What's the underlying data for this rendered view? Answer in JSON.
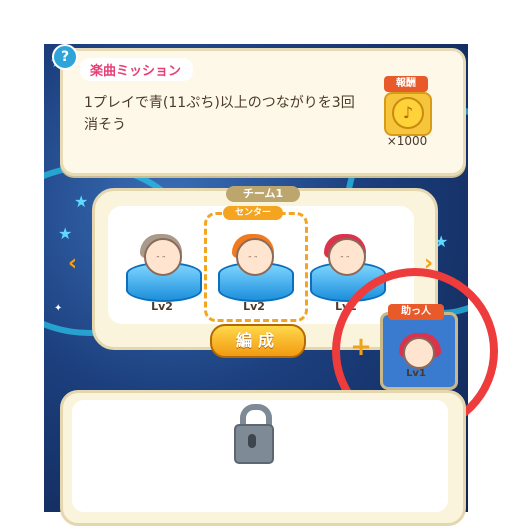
{
  "mission": {
    "title": "楽曲ミッション",
    "description": "1プレイで青(11ぷち)以上のつながりを3回消そう",
    "reward_label": "報酬",
    "reward_count": "×1000",
    "icons": {
      "help": "question-icon",
      "reward": "music-coin-icon"
    }
  },
  "team": {
    "label": "チーム1",
    "center_label": "センター",
    "members": [
      {
        "level": "Lv2",
        "hair_color": "#a99a8c"
      },
      {
        "level": "Lv2",
        "hair_color": "#f27a1e"
      },
      {
        "level": "Lv2",
        "hair_color": "#d9344c"
      }
    ],
    "edit_button": "編成",
    "icons": {
      "prev": "chevron-left-icon",
      "next": "chevron-right-icon"
    }
  },
  "helper": {
    "label": "助っ人",
    "level": "Lv1",
    "hair_color": "#d9344c",
    "icons": {
      "add": "plus-icon"
    }
  },
  "locked_slot": {
    "icon": "lock-icon"
  },
  "colors": {
    "accent_orange": "#f4a41f",
    "highlight_ring": "#ee3b3b",
    "title_pink": "#e83f79"
  }
}
